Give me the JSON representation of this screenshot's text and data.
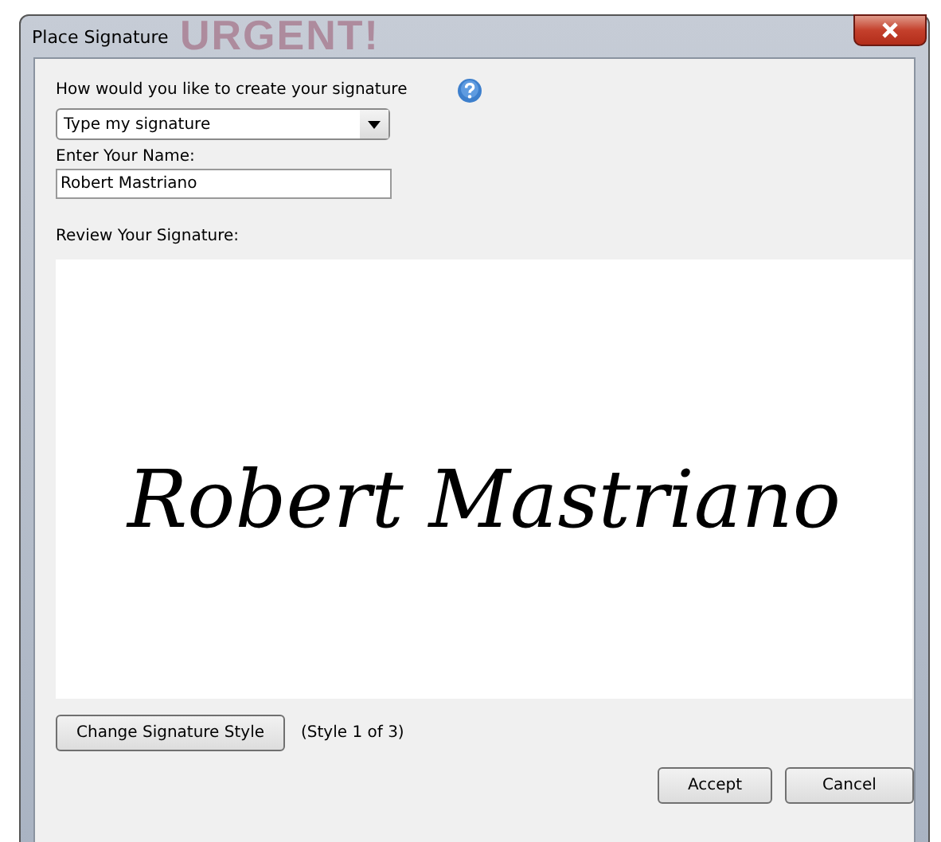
{
  "window": {
    "title": "Place Signature",
    "backdrop_text": "URGENT!"
  },
  "method": {
    "label": "How would you like to create your signature",
    "value": "Type my signature"
  },
  "name": {
    "label": "Enter Your Name:",
    "value": "Robert Mastriano"
  },
  "review": {
    "label": "Review Your Signature:",
    "signature": "Robert Mastriano"
  },
  "style": {
    "button": "Change Signature Style",
    "status": "(Style 1 of 3)"
  },
  "buttons": [
    "Accept",
    "Cancel"
  ]
}
